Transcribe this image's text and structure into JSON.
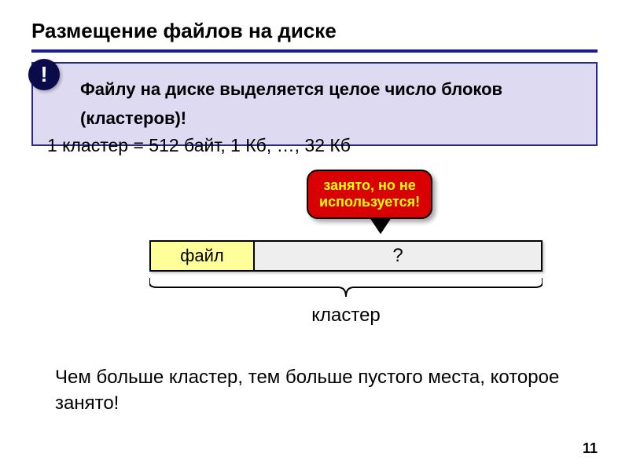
{
  "title": "Размещение файлов на диске",
  "callout": {
    "bang": "!",
    "line1": "Файлу на диске выделяется целое число блоков",
    "line2": "(кластеров)!"
  },
  "cluster_eq": "1 кластер = 512 байт, 1 Кб, …, 32 Кб",
  "speech": {
    "line1": "занято, но не",
    "line2": "используется!"
  },
  "bar": {
    "file_label": "файл",
    "rest_label": "?"
  },
  "brace_label": "кластер",
  "bottom_text": "Чем больше кластер, тем больше пустого места, которое занято!",
  "page_number": "11"
}
